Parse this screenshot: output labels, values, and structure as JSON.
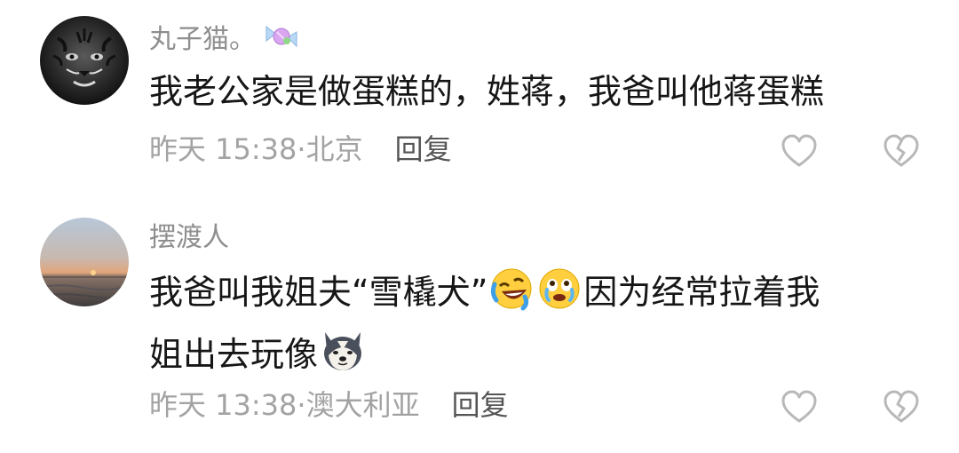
{
  "comments": [
    {
      "username": "丸子猫。",
      "username_icon": "candy-icon",
      "text": "我老公家是做蛋糕的，姓蒋，我爸叫他蒋蛋糕",
      "time": "昨天 15:38",
      "separator": "·",
      "location": "北京",
      "reply_label": "回复"
    },
    {
      "username": "摆渡人",
      "text_line1_a": "我爸叫我姐夫“雪橇犬”",
      "emoji1": "rolling-laughing-icon",
      "emoji2": "tearful-face-icon",
      "text_line1_b": "因为经常拉着我",
      "text_line2": "姐出去玩像",
      "emoji3": "husky-dog-icon",
      "time": "昨天 13:38",
      "separator": "·",
      "location": "澳大利亚",
      "reply_label": "回复"
    }
  ],
  "icons": {
    "like": "heart-outline-icon",
    "dislike": "broken-heart-icon"
  },
  "colors": {
    "meta_text": "#a3a3a3",
    "username_text": "#8e8e8e",
    "reply_text": "#555555",
    "icon_stroke": "#b8b8b8"
  }
}
